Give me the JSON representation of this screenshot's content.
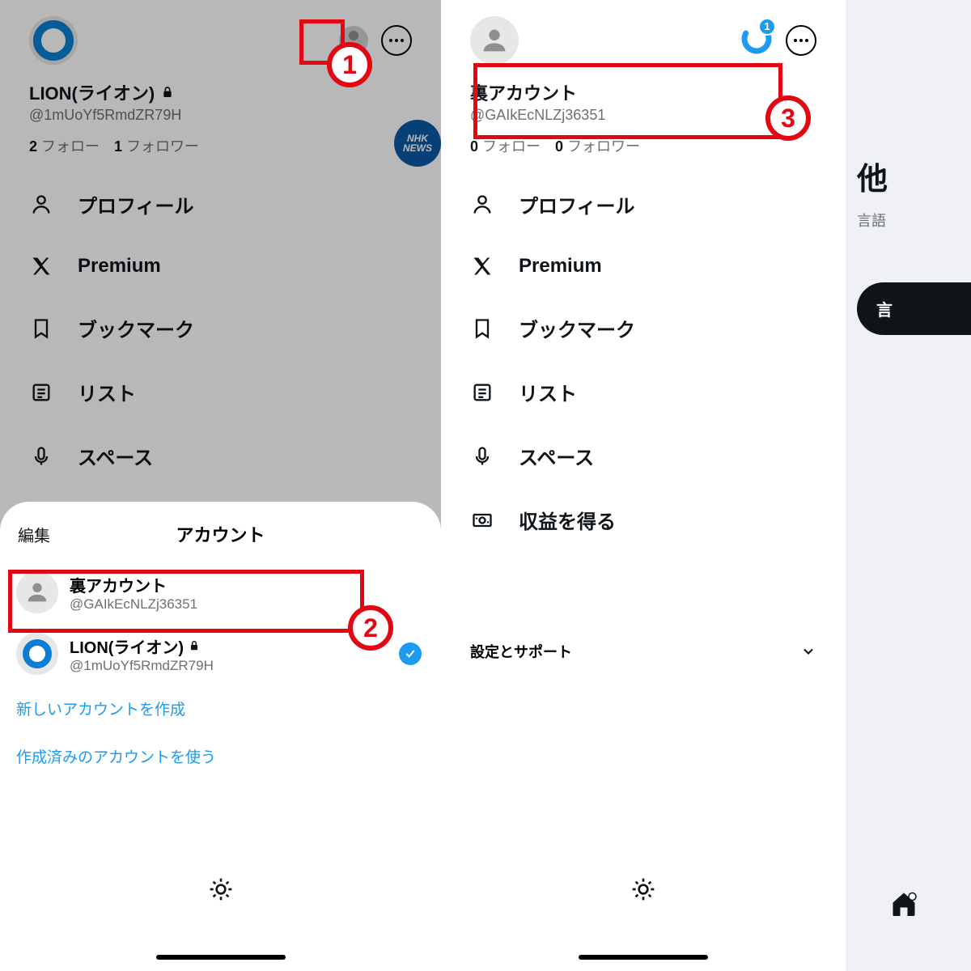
{
  "left": {
    "display_name": "LION(ライオン)",
    "handle": "@1mUoYf5RmdZR79H",
    "following_n": "2",
    "following_label": "フォロー",
    "followers_n": "1",
    "followers_label": "フォロワー",
    "nhk_top": "NHK",
    "nhk_bot": "NEWS"
  },
  "menu": {
    "profile": "プロフィール",
    "premium": "Premium",
    "bookmarks": "ブックマーク",
    "lists": "リスト",
    "spaces": "スペース",
    "monetize": "収益を得る"
  },
  "sheet": {
    "edit": "編集",
    "title": "アカウント",
    "acct1_name": "裏アカウント",
    "acct1_handle": "@GAIkEcNLZj36351",
    "acct2_name": "LION(ライオン)",
    "acct2_handle": "@1mUoYf5RmdZR79H",
    "link_create": "新しいアカウントを作成",
    "link_existing": "作成済みのアカウントを使う"
  },
  "right": {
    "display_name": "裏アカウント",
    "handle": "@GAIkEcNLZj36351",
    "following_n": "0",
    "following_label": "フォロー",
    "followers_n": "0",
    "followers_label": "フォロワー",
    "notif_count": "1",
    "settings": "設定とサポート"
  },
  "extra": {
    "title": "他",
    "sub": "言語",
    "btn": "言"
  },
  "anno": {
    "n1": "1",
    "n2": "2",
    "n3": "3"
  }
}
